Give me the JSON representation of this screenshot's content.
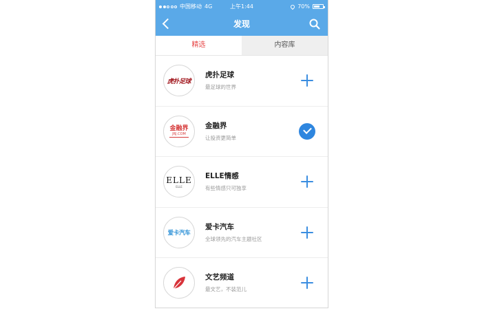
{
  "status_bar": {
    "signal_bars": 5,
    "signal_filled": 2,
    "carrier": "中国移动",
    "network": "4G",
    "time": "上午1:44",
    "battery": "70%",
    "battery_level": 0.7
  },
  "navbar": {
    "title": "发现",
    "back_icon": "chevron-left-icon",
    "search_icon": "search-icon"
  },
  "tabs": [
    {
      "label": "精选",
      "active": true
    },
    {
      "label": "内容库",
      "active": false
    }
  ],
  "items": [
    {
      "logo_text": "虎扑足球",
      "name": "虎扑足球",
      "desc": "最足球的世界",
      "subscribed": false
    },
    {
      "logo_text": "金融界",
      "logo_sub": "JRJ.COM",
      "name": "金融界",
      "desc": "让投资更简单",
      "subscribed": true
    },
    {
      "logo_text": "ELLE",
      "logo_sub": "ELLE",
      "name": "ELLE情感",
      "desc": "有些情感只可独享",
      "subscribed": false
    },
    {
      "logo_text": "爱卡汽车",
      "name": "爱卡汽车",
      "desc": "全球领先的汽车主题社区",
      "subscribed": false
    },
    {
      "logo_text": "",
      "name": "文艺频道",
      "desc": "最文艺，不装范儿",
      "subscribed": false
    }
  ],
  "colors": {
    "header": "#5aa9e8",
    "active_tab": "#e64646",
    "accent": "#2e86df"
  }
}
